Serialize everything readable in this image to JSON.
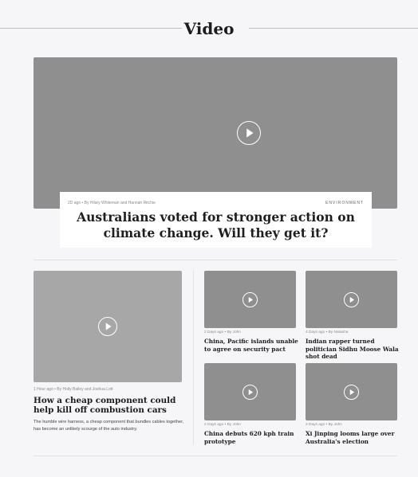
{
  "section": {
    "title": "Video"
  },
  "hero": {
    "meta": "2D ago • By Hilary Whiteman and Hannah Ritchie",
    "tag": "ENVIRONMENT",
    "headline": "Australians voted for stronger action on climate change. Will they get it?",
    "play_icon": "play-icon"
  },
  "feature": {
    "meta": "1 Hour ago • By Holly Bailey and Joshua Lott",
    "title": "How a cheap component could help kill off combustion cars",
    "description": "The humble wire harness, a cheap component that bundles cables together, has become an unlikely scourge of the auto industry."
  },
  "small_stories": [
    {
      "meta": "2 Days ago • By John",
      "title": "China, Pacific islands unable to agree on security pact"
    },
    {
      "meta": "4 Days ago • By Natasha",
      "title": "Indian rapper turned politician Sidhu Moose Wala shot dead"
    },
    {
      "meta": "2 Days ago • By John",
      "title": "China debuts 620 kph train prototype"
    },
    {
      "meta": "2 Days ago • By John",
      "title": "Xi Jinping looms large over Australia's election"
    }
  ],
  "colors": {
    "background": "#f6f6f9",
    "video_placeholder": "#8f8f8f",
    "feature_placeholder": "#a7a7a7"
  }
}
